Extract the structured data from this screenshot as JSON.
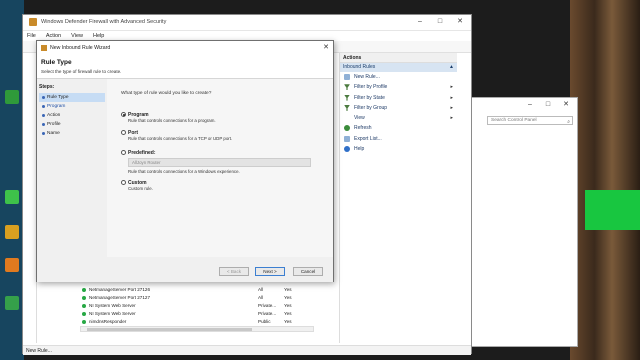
{
  "main_window": {
    "title": "Windows Defender Firewall with Advanced Security",
    "menu": [
      "File",
      "Action",
      "View",
      "Help"
    ],
    "status": "New Rule..."
  },
  "actions": {
    "header": "Actions",
    "section": "Inbound Rules",
    "items": [
      {
        "label": "New Rule...",
        "icon": "new-rule-icon",
        "arrow": ""
      },
      {
        "label": "Filter by Profile",
        "icon": "filter-icon",
        "arrow": "▸"
      },
      {
        "label": "Filter by State",
        "icon": "filter-icon",
        "arrow": "▸"
      },
      {
        "label": "Filter by Group",
        "icon": "filter-icon",
        "arrow": "▸"
      },
      {
        "label": "View",
        "icon": "",
        "arrow": "▸"
      },
      {
        "label": "Refresh",
        "icon": "refresh-icon",
        "arrow": ""
      },
      {
        "label": "Export List...",
        "icon": "export-icon",
        "arrow": ""
      },
      {
        "label": "Help",
        "icon": "help-icon",
        "arrow": ""
      }
    ]
  },
  "rules": [
    {
      "name": "NetmanageServer Port 27126",
      "profile": "All",
      "enabled": "Yes"
    },
    {
      "name": "NetmanageServer Port 27127",
      "profile": "All",
      "enabled": "Yes"
    },
    {
      "name": "NI System Web Server",
      "profile": "Private...",
      "enabled": "Yes"
    },
    {
      "name": "NI System Web Server",
      "profile": "Private...",
      "enabled": "Yes"
    },
    {
      "name": "nimdnsResponder",
      "profile": "Public",
      "enabled": "Yes"
    }
  ],
  "control_panel": {
    "search_placeholder": "Search Control Panel"
  },
  "wizard": {
    "title": "New Inbound Rule Wizard",
    "heading": "Rule Type",
    "description": "Select the type of firewall rule to create.",
    "steps_title": "Steps:",
    "steps": [
      "Rule Type",
      "Program",
      "Action",
      "Profile",
      "Name"
    ],
    "question": "What type of rule would you like to create?",
    "options": [
      {
        "label": "Program",
        "sub": "Rule that controls connections for a program.",
        "selected": true
      },
      {
        "label": "Port",
        "sub": "Rule that controls connections for a TCP or UDP port.",
        "selected": false
      },
      {
        "label": "Predefined:",
        "sub": "Rule that controls connections for a Windows experience.",
        "selected": false
      },
      {
        "label": "Custom",
        "sub": "Custom rule.",
        "selected": false
      }
    ],
    "predefined_value": "AllJoyn Router",
    "buttons": {
      "back": "< Back",
      "next": "Next >",
      "cancel": "Cancel"
    }
  },
  "colors": {
    "accent": "#3a66b5",
    "selection": "#c6dcf4",
    "actions_section": "#d7e4f2",
    "enabled_dot": "#27a844"
  }
}
